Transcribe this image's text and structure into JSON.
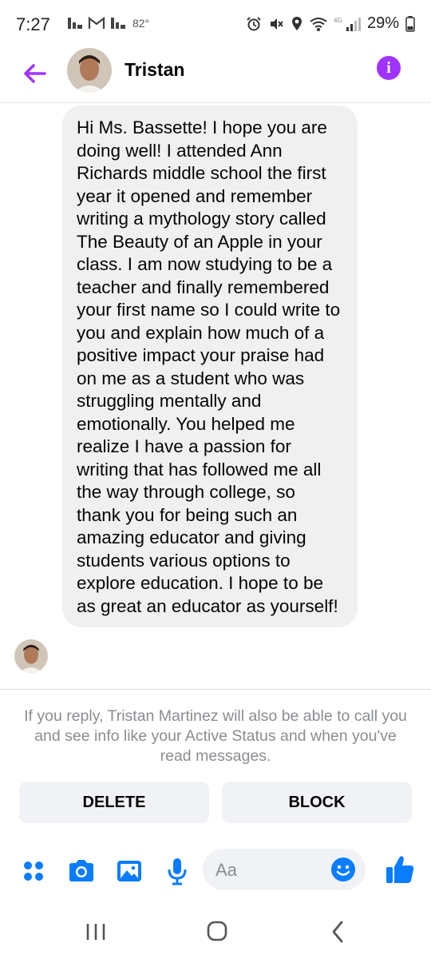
{
  "status_bar": {
    "time": "7:27",
    "temperature": "82°",
    "battery": "29%",
    "network": "4G"
  },
  "header": {
    "contact_name": "Tristan"
  },
  "message": {
    "text": "Hi Ms. Bassette! I hope you are doing well! I attended Ann Richards middle school the first year it opened and remember writing a mythology story called The Beauty of an Apple in your class. I am now studying to be a teacher and finally remembered your first name so I could write to you and explain how much of a positive impact your praise had on me as a student who was struggling mentally and emotionally. You helped me realize I have a passion for writing that has followed me all the way through college, so thank you for being such an amazing educator and giving students various options to explore education. I hope to be as great an educator as yourself!"
  },
  "request_notice": "If you reply, Tristan Martinez will also be able to call you and see info like your Active Status and when you've read messages.",
  "actions": {
    "delete_label": "DELETE",
    "block_label": "BLOCK"
  },
  "composer": {
    "placeholder": "Aa"
  },
  "colors": {
    "accent_purple": "#a033ff",
    "accent_blue": "#0a7cff",
    "bubble_bg": "#f0f0f0"
  },
  "icons": [
    "back-arrow-icon",
    "info-icon",
    "menu-dots-icon",
    "camera-icon",
    "image-icon",
    "microphone-icon",
    "emoji-icon",
    "thumbs-up-icon",
    "recent-apps-icon",
    "home-icon",
    "back-icon"
  ]
}
